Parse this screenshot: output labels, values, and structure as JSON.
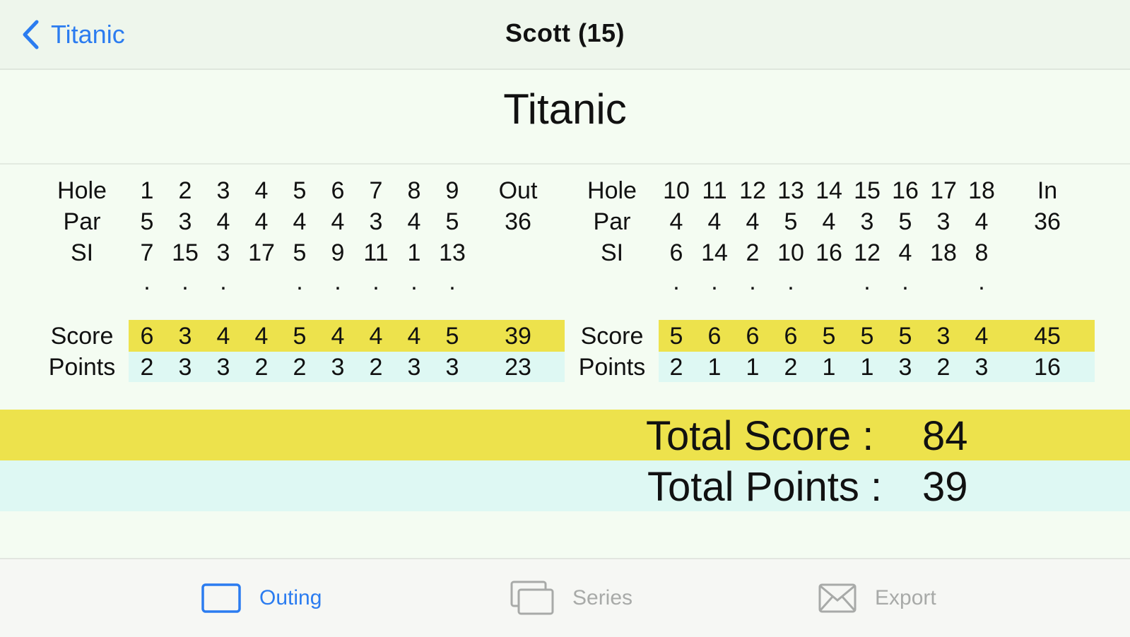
{
  "nav": {
    "back_label": "Titanic",
    "title": "Scott  (15)"
  },
  "course_title": "Titanic",
  "front": {
    "labels": {
      "hole": "Hole",
      "par": "Par",
      "si": "SI",
      "score": "Score",
      "points": "Points"
    },
    "holes": [
      "1",
      "2",
      "3",
      "4",
      "5",
      "6",
      "7",
      "8",
      "9"
    ],
    "total_label": "Out",
    "par": [
      "5",
      "3",
      "4",
      "4",
      "4",
      "4",
      "3",
      "4",
      "5"
    ],
    "par_total": "36",
    "si": [
      "7",
      "15",
      "3",
      "17",
      "5",
      "9",
      "11",
      "1",
      "13"
    ],
    "dots": [
      true,
      true,
      true,
      false,
      true,
      true,
      true,
      true,
      true
    ],
    "score": [
      "6",
      "3",
      "4",
      "4",
      "5",
      "4",
      "4",
      "4",
      "5"
    ],
    "score_total": "39",
    "points": [
      "2",
      "3",
      "3",
      "2",
      "2",
      "3",
      "2",
      "3",
      "3"
    ],
    "points_total": "23"
  },
  "back": {
    "labels": {
      "hole": "Hole",
      "par": "Par",
      "si": "SI",
      "score": "Score",
      "points": "Points"
    },
    "holes": [
      "10",
      "11",
      "12",
      "13",
      "14",
      "15",
      "16",
      "17",
      "18"
    ],
    "total_label": "In",
    "par": [
      "4",
      "4",
      "4",
      "5",
      "4",
      "3",
      "5",
      "3",
      "4"
    ],
    "par_total": "36",
    "si": [
      "6",
      "14",
      "2",
      "10",
      "16",
      "12",
      "4",
      "18",
      "8"
    ],
    "dots": [
      true,
      true,
      true,
      true,
      false,
      true,
      true,
      false,
      true
    ],
    "score": [
      "5",
      "6",
      "6",
      "6",
      "5",
      "5",
      "5",
      "3",
      "4"
    ],
    "score_total": "45",
    "points": [
      "2",
      "1",
      "1",
      "2",
      "1",
      "1",
      "3",
      "2",
      "3"
    ],
    "points_total": "16"
  },
  "totals": {
    "score_label": "Total Score :",
    "score_value": "84",
    "points_label": "Total Points :",
    "points_value": "39"
  },
  "tabs": [
    {
      "label": "Outing",
      "icon": "outing-icon",
      "active": true
    },
    {
      "label": "Series",
      "icon": "series-icon",
      "active": false
    },
    {
      "label": "Export",
      "icon": "export-icon",
      "active": false
    }
  ],
  "colors": {
    "accent": "#2b7cf0",
    "score_band": "#ede24c",
    "points_band": "#def8f3",
    "background": "#f4fcf2"
  }
}
